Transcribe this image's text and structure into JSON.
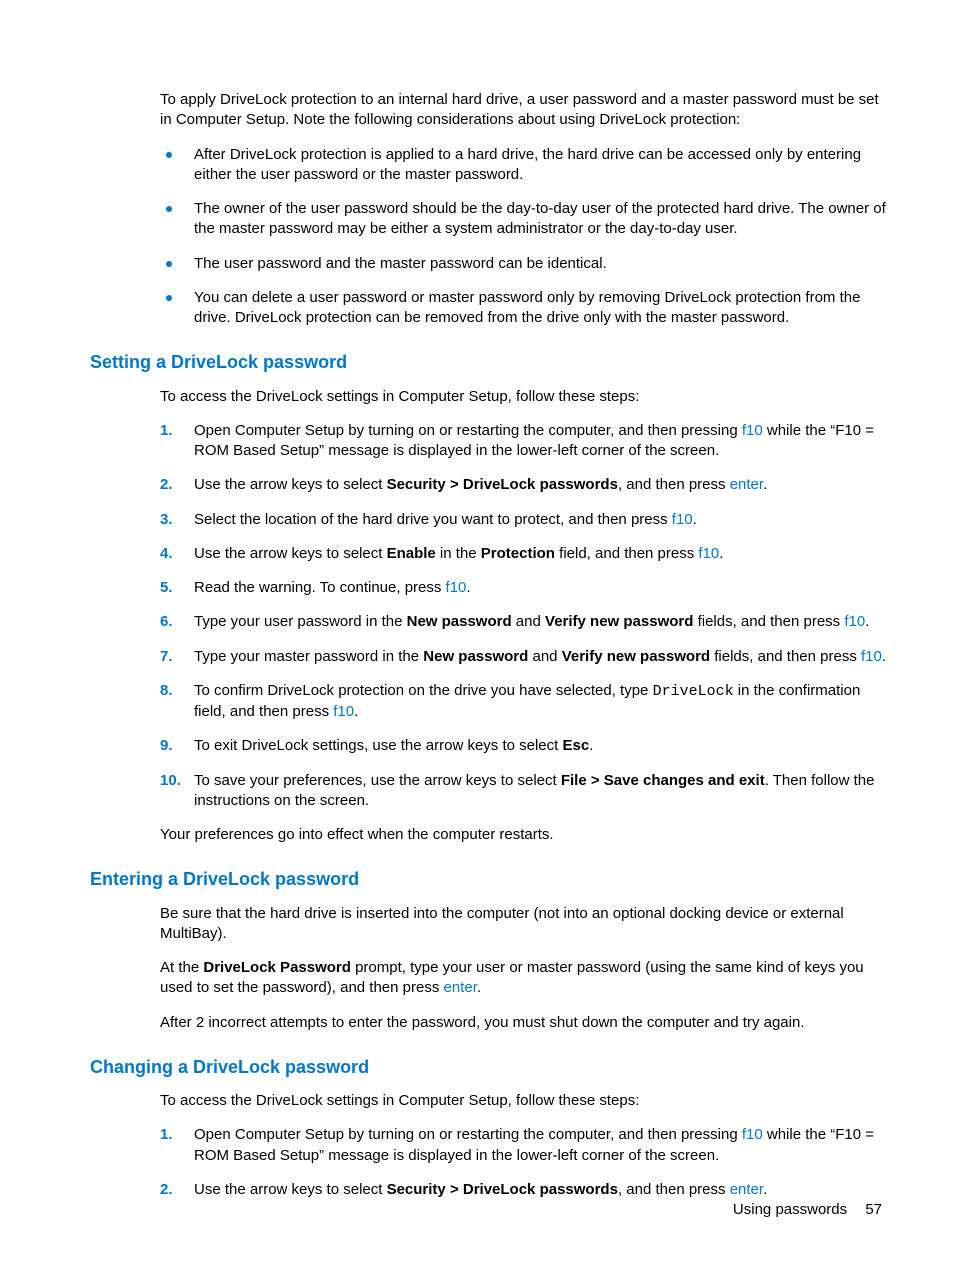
{
  "intro": {
    "p1": "To apply DriveLock protection to an internal hard drive, a user password and a master password must be set in Computer Setup. Note the following considerations about using DriveLock protection:",
    "bullets": [
      "After DriveLock protection is applied to a hard drive, the hard drive can be accessed only by entering either the user password or the master password.",
      "The owner of the user password should be the day-to-day user of the protected hard drive. The owner of the master password may be either a system administrator or the day-to-day user.",
      "The user password and the master password can be identical.",
      "You can delete a user password or master password only by removing DriveLock protection from the drive. DriveLock protection can be removed from the drive only with the master password."
    ]
  },
  "setting": {
    "heading": "Setting a DriveLock password",
    "p1": "To access the DriveLock settings in Computer Setup, follow these steps:",
    "steps": {
      "s1a": "Open Computer Setup by turning on or restarting the computer, and then pressing ",
      "s1key": "f10",
      "s1b": " while the “F10 = ROM Based Setup” message is displayed in the lower-left corner of the screen.",
      "s2a": "Use the arrow keys to select ",
      "s2bold": "Security > DriveLock passwords",
      "s2b": ", and then press ",
      "s2key": "enter",
      "s2c": ".",
      "s3a": "Select the location of the hard drive you want to protect, and then press ",
      "s3key": "f10",
      "s3b": ".",
      "s4a": "Use the arrow keys to select ",
      "s4bold1": "Enable",
      "s4b": " in the ",
      "s4bold2": "Protection",
      "s4c": " field, and then press ",
      "s4key": "f10",
      "s4d": ".",
      "s5a": "Read the warning. To continue, press ",
      "s5key": "f10",
      "s5b": ".",
      "s6a": "Type your user password in the ",
      "s6bold1": "New password",
      "s6b": " and ",
      "s6bold2": "Verify new password",
      "s6c": " fields, and then press ",
      "s6key": "f10",
      "s6d": ".",
      "s7a": "Type your master password in the ",
      "s7bold1": "New password",
      "s7b": " and ",
      "s7bold2": "Verify new password",
      "s7c": " fields, and then press ",
      "s7key": "f10",
      "s7d": ".",
      "s8a": "To confirm DriveLock protection on the drive you have selected, type ",
      "s8mono": "DriveLock",
      "s8b": " in the confirmation field, and then press ",
      "s8key": "f10",
      "s8c": ".",
      "s9a": "To exit DriveLock settings, use the arrow keys to select ",
      "s9bold": "Esc",
      "s9b": ".",
      "s10a": "To save your preferences, use the arrow keys to select ",
      "s10bold": "File > Save changes and exit",
      "s10b": ". Then follow the instructions on the screen."
    },
    "p2": "Your preferences go into effect when the computer restarts."
  },
  "entering": {
    "heading": "Entering a DriveLock password",
    "p1": "Be sure that the hard drive is inserted into the computer (not into an optional docking device or external MultiBay).",
    "p2a": "At the ",
    "p2bold": "DriveLock Password",
    "p2b": " prompt, type your user or master password (using the same kind of keys you used to set the password), and then press ",
    "p2key": "enter",
    "p2c": ".",
    "p3": "After 2 incorrect attempts to enter the password, you must shut down the computer and try again."
  },
  "changing": {
    "heading": "Changing a DriveLock password",
    "p1": "To access the DriveLock settings in Computer Setup, follow these steps:",
    "steps": {
      "s1a": "Open Computer Setup by turning on or restarting the computer, and then pressing ",
      "s1key": "f10",
      "s1b": " while the “F10 = ROM Based Setup” message is displayed in the lower-left corner of the screen.",
      "s2a": "Use the arrow keys to select ",
      "s2bold": "Security > DriveLock passwords",
      "s2b": ", and then press ",
      "s2key": "enter",
      "s2c": "."
    }
  },
  "footer": {
    "label": "Using passwords",
    "page": "57"
  }
}
